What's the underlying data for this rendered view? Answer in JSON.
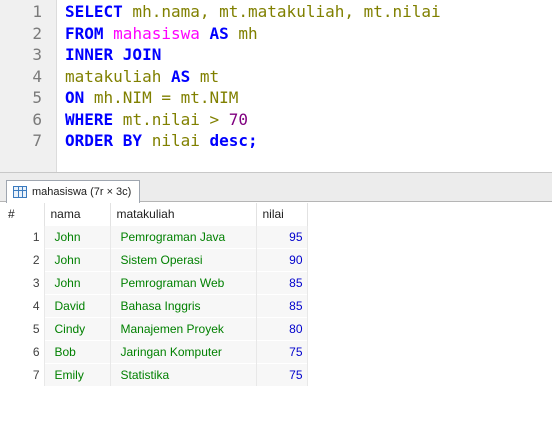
{
  "editor": {
    "lines": [
      {
        "n": "1",
        "tokens": [
          [
            "kw",
            "SELECT"
          ],
          [
            "op",
            " mh.nama, mt.matakuliah, mt.nilai"
          ]
        ]
      },
      {
        "n": "2",
        "tokens": [
          [
            "kw",
            "FROM"
          ],
          [
            "op",
            " "
          ],
          [
            "tbl",
            "mahasiswa"
          ],
          [
            "op",
            " "
          ],
          [
            "kw",
            "AS"
          ],
          [
            "op",
            " mh"
          ]
        ]
      },
      {
        "n": "3",
        "tokens": [
          [
            "kw",
            "INNER JOIN"
          ]
        ]
      },
      {
        "n": "4",
        "tokens": [
          [
            "op",
            "matakuliah "
          ],
          [
            "kw",
            "AS"
          ],
          [
            "op",
            " mt"
          ]
        ]
      },
      {
        "n": "5",
        "tokens": [
          [
            "kw",
            "ON"
          ],
          [
            "op",
            " mh.NIM = mt.NIM"
          ]
        ]
      },
      {
        "n": "6",
        "tokens": [
          [
            "kw",
            "WHERE"
          ],
          [
            "op",
            " mt.nilai > "
          ],
          [
            "num",
            "70"
          ]
        ]
      },
      {
        "n": "7",
        "tokens": [
          [
            "kw",
            "ORDER BY"
          ],
          [
            "op",
            " nilai "
          ],
          [
            "kw",
            "desc"
          ],
          [
            "kw",
            ";"
          ]
        ]
      }
    ]
  },
  "result_tab": {
    "label": "mahasiswa (7r × 3c)",
    "icon": "table-grid-icon"
  },
  "grid": {
    "columns": [
      "#",
      "nama",
      "matakuliah",
      "nilai"
    ],
    "rows": [
      [
        "1",
        "John",
        "Pemrograman Java",
        "95"
      ],
      [
        "2",
        "John",
        "Sistem Operasi",
        "90"
      ],
      [
        "3",
        "John",
        "Pemrograman Web",
        "85"
      ],
      [
        "4",
        "David",
        "Bahasa Inggris",
        "85"
      ],
      [
        "5",
        "Cindy",
        "Manajemen Proyek",
        "80"
      ],
      [
        "6",
        "Bob",
        "Jaringan Komputer",
        "75"
      ],
      [
        "7",
        "Emily",
        "Statistika",
        "75"
      ]
    ]
  }
}
